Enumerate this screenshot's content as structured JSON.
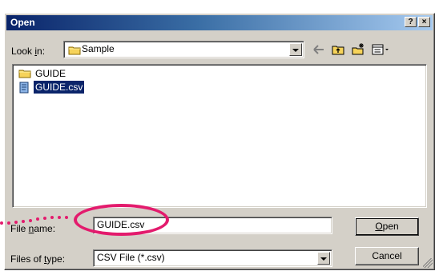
{
  "window": {
    "title": "Open",
    "help_button": "?",
    "close_button": "×"
  },
  "look_in": {
    "label_prefix": "Look ",
    "label_underlined": "i",
    "label_suffix": "n:",
    "value": "Sample"
  },
  "toolbar": {
    "icons": [
      "back-arrow-icon",
      "up-folder-icon",
      "new-folder-icon",
      "view-menu-icon"
    ]
  },
  "file_list": {
    "items": [
      {
        "name": "GUIDE",
        "type": "folder",
        "selected": false
      },
      {
        "name": "GUIDE.csv",
        "type": "file",
        "selected": true
      }
    ]
  },
  "file_name": {
    "label_prefix": "File ",
    "label_underlined": "n",
    "label_suffix": "ame:",
    "value": "GUIDE.csv"
  },
  "file_type": {
    "label_prefix": "Files of ",
    "label_underlined": "t",
    "label_suffix": "ype:",
    "value": "CSV File (*.csv)"
  },
  "buttons": {
    "open_prefix": "",
    "open_underlined": "O",
    "open_suffix": "pen",
    "cancel": "Cancel"
  },
  "colors": {
    "highlight": "#e31b6d",
    "title_bar": "#0a246a",
    "dialog": "#d4d0c8"
  }
}
